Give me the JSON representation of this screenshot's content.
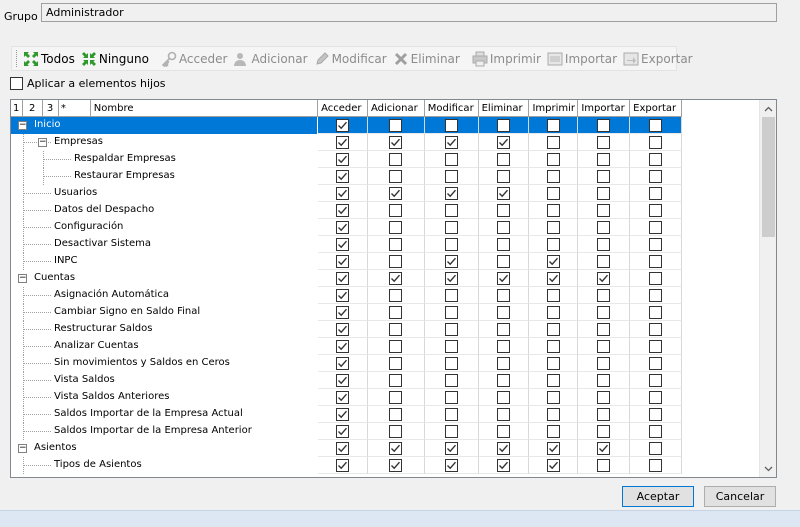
{
  "grupo": {
    "label": "Grupo",
    "value": "Administrador"
  },
  "toolbar": {
    "todos": "Todos",
    "ninguno": "Ninguno",
    "acceder": "Acceder",
    "adicionar": "Adicionar",
    "modificar": "Modificar",
    "eliminar": "Eliminar",
    "imprimir": "Imprimir",
    "importar": "Importar",
    "exportar": "Exportar"
  },
  "apply_children": {
    "label": "Aplicar a elementos hijos",
    "checked": false
  },
  "grid": {
    "level_headers": [
      "1",
      "2",
      "3",
      "*"
    ],
    "name_header": "Nombre",
    "columns": [
      "Acceder",
      "Adicionar",
      "Modificar",
      "Eliminar",
      "Imprimir",
      "Importar",
      "Exportar"
    ],
    "rows": [
      {
        "name": "Inicio",
        "level": 0,
        "expander": "−",
        "selected": true,
        "checks": [
          1,
          0,
          0,
          0,
          0,
          0,
          0
        ]
      },
      {
        "name": "Empresas",
        "level": 1,
        "expander": "−",
        "selected": false,
        "checks": [
          1,
          1,
          1,
          1,
          0,
          0,
          0
        ]
      },
      {
        "name": "Respaldar Empresas",
        "level": 2,
        "expander": "",
        "selected": false,
        "checks": [
          1,
          0,
          0,
          0,
          0,
          0,
          0
        ]
      },
      {
        "name": "Restaurar Empresas",
        "level": 2,
        "expander": "",
        "selected": false,
        "checks": [
          1,
          0,
          0,
          0,
          0,
          0,
          0
        ]
      },
      {
        "name": "Usuarios",
        "level": 1,
        "expander": "",
        "selected": false,
        "checks": [
          1,
          1,
          1,
          1,
          0,
          0,
          0
        ]
      },
      {
        "name": "Datos del Despacho",
        "level": 1,
        "expander": "",
        "selected": false,
        "checks": [
          1,
          0,
          0,
          0,
          0,
          0,
          0
        ]
      },
      {
        "name": "Configuración",
        "level": 1,
        "expander": "",
        "selected": false,
        "checks": [
          1,
          0,
          0,
          0,
          0,
          0,
          0
        ]
      },
      {
        "name": "Desactivar Sistema",
        "level": 1,
        "expander": "",
        "selected": false,
        "checks": [
          1,
          0,
          0,
          0,
          0,
          0,
          0
        ]
      },
      {
        "name": "INPC",
        "level": 1,
        "expander": "",
        "selected": false,
        "checks": [
          1,
          0,
          1,
          0,
          1,
          0,
          0
        ]
      },
      {
        "name": "Cuentas",
        "level": 0,
        "expander": "−",
        "selected": false,
        "checks": [
          1,
          1,
          1,
          1,
          1,
          1,
          0
        ]
      },
      {
        "name": "Asignación Automática",
        "level": 1,
        "expander": "",
        "selected": false,
        "checks": [
          1,
          0,
          0,
          0,
          0,
          0,
          0
        ]
      },
      {
        "name": "Cambiar Signo en Saldo Final",
        "level": 1,
        "expander": "",
        "selected": false,
        "checks": [
          1,
          0,
          0,
          0,
          0,
          0,
          0
        ]
      },
      {
        "name": "Restructurar Saldos",
        "level": 1,
        "expander": "",
        "selected": false,
        "checks": [
          1,
          0,
          0,
          0,
          0,
          0,
          0
        ]
      },
      {
        "name": "Analizar Cuentas",
        "level": 1,
        "expander": "",
        "selected": false,
        "checks": [
          1,
          0,
          0,
          0,
          0,
          0,
          0
        ]
      },
      {
        "name": "Sin movimientos y Saldos en Ceros",
        "level": 1,
        "expander": "",
        "selected": false,
        "checks": [
          1,
          0,
          0,
          0,
          0,
          0,
          0
        ]
      },
      {
        "name": "Vista Saldos",
        "level": 1,
        "expander": "",
        "selected": false,
        "checks": [
          1,
          0,
          0,
          0,
          0,
          0,
          0
        ]
      },
      {
        "name": "Vista Saldos Anteriores",
        "level": 1,
        "expander": "",
        "selected": false,
        "checks": [
          1,
          0,
          0,
          0,
          0,
          0,
          0
        ]
      },
      {
        "name": "Saldos Importar de la Empresa Actual",
        "level": 1,
        "expander": "",
        "selected": false,
        "checks": [
          1,
          0,
          0,
          0,
          0,
          0,
          0
        ]
      },
      {
        "name": "Saldos Importar de la Empresa Anterior",
        "level": 1,
        "expander": "",
        "selected": false,
        "checks": [
          1,
          0,
          0,
          0,
          0,
          0,
          0
        ]
      },
      {
        "name": "Asientos",
        "level": 0,
        "expander": "−",
        "selected": false,
        "checks": [
          1,
          1,
          1,
          1,
          1,
          1,
          0
        ]
      },
      {
        "name": "Tipos de Asientos",
        "level": 1,
        "expander": "",
        "selected": false,
        "checks": [
          1,
          1,
          1,
          1,
          1,
          0,
          0
        ]
      }
    ]
  },
  "buttons": {
    "accept": "Aceptar",
    "cancel": "Cancelar"
  },
  "colors": {
    "selection": "#0078d7",
    "check_mark": "#333333"
  }
}
